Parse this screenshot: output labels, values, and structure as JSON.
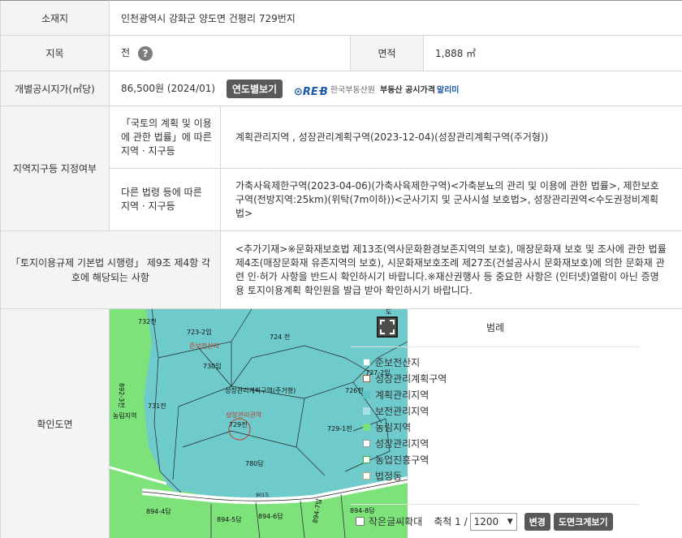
{
  "info": {
    "location_label": "소재지",
    "location_value": "인천광역시 강화군 양도면 건평리 729번지",
    "landtype_label": "지목",
    "landtype_value": "전",
    "help_glyph": "?",
    "area_label": "면적",
    "area_value": "1,888 ㎡",
    "price_label": "개별공시지가(㎡당)",
    "price_value": "86,500원 (2024/01)",
    "yearly_button": "연도별보기",
    "reb_logo": "⊙RE᠊B",
    "reb_org": "한국부동산원",
    "reb_service": "부동산 공시가격",
    "reb_alert": "알리미"
  },
  "zoning": {
    "label": "지역지구등 지정여부",
    "national_label": "「국토의 계획 및 이용에 관한 법률」에 따른 지역 · 지구등",
    "national_value": "계획관리지역 , 성장관리계획구역(2023-12-04)(성장관리계획구역(주거형))",
    "other_label": "다른 법령 등에 따른 지역 · 지구등",
    "other_value": "가축사육제한구역(2023-04-06)(가축사육제한구역)<가축분뇨의 관리 및 이용에 관한 법률>, 제한보호구역(전방지역:25km)(위탁(7m이하))<군사기지 및 군사시설 보호법>, 성장관리권역<수도권정비계획법>"
  },
  "regulation": {
    "label": "「토지이용규제 기본법 시행령」 제9조 제4항 각 호에 해당되는 사항",
    "value": "<추가기재>※문화재보호법 제13조(역사문화환경보존지역의 보호), 매장문화재 보호 및 조사에 관한 법률 제4조(매장문화재 유존지역의 보호), 시문화재보호조례 제27조(건설공사시 문화재보호)에 의한 문화재 관련 인·허가 사항을 반드시 확인하시기 바랍니다.※재산권행사 등 중요한 사항은 (인터넷)열람이 아닌 증명용 토지이용계획 확인원을 발급 받아 확인하시기 바랍니다."
  },
  "map": {
    "label": "확인도면",
    "parcels": [
      "732전",
      "723-2임",
      "724 전",
      "730임",
      "727-2임",
      "731전",
      "726전",
      "729-1전",
      "729전",
      "780답",
      "894-4답",
      "894-5답",
      "894-6답",
      "894-7답",
      "894-8답",
      "892-3전"
    ],
    "zone_labels": [
      "준보전산지",
      "성장관리계획구역(주거형)",
      "성장관리권역",
      "농림지역"
    ],
    "road_label": "901도",
    "corner_label": "도",
    "fullscreen_icon": "fullscreen-icon"
  },
  "legend": {
    "title": "범례",
    "items": [
      {
        "label": "준보전산지",
        "color": "#7fd3d4",
        "fill": "#ffffff"
      },
      {
        "label": "성장관리계획구역",
        "color": "#a05a2c",
        "fill": "#ffffff"
      },
      {
        "label": "계획관리지역",
        "color": "#5ec4c6",
        "fill": "#5ec4c6"
      },
      {
        "label": "보전관리지역",
        "color": "#a8e2e4",
        "fill": "#a8e2e4"
      },
      {
        "label": "농림지역",
        "color": "#7be07b",
        "fill": "#7be07b"
      },
      {
        "label": "성장관리지역",
        "color": "#999999",
        "fill": "#ffffff"
      },
      {
        "label": "농업진흥구역",
        "color": "#3cb043",
        "fill": "#ffffff"
      },
      {
        "label": "법정동",
        "color": "#c9a97a",
        "fill": "#ffffff"
      }
    ],
    "small_text_label": "작은글씨확대",
    "scale_label": "축척 1 /",
    "scale_value": "1200",
    "change_button": "변경",
    "enlarge_button": "도면크게보기"
  }
}
